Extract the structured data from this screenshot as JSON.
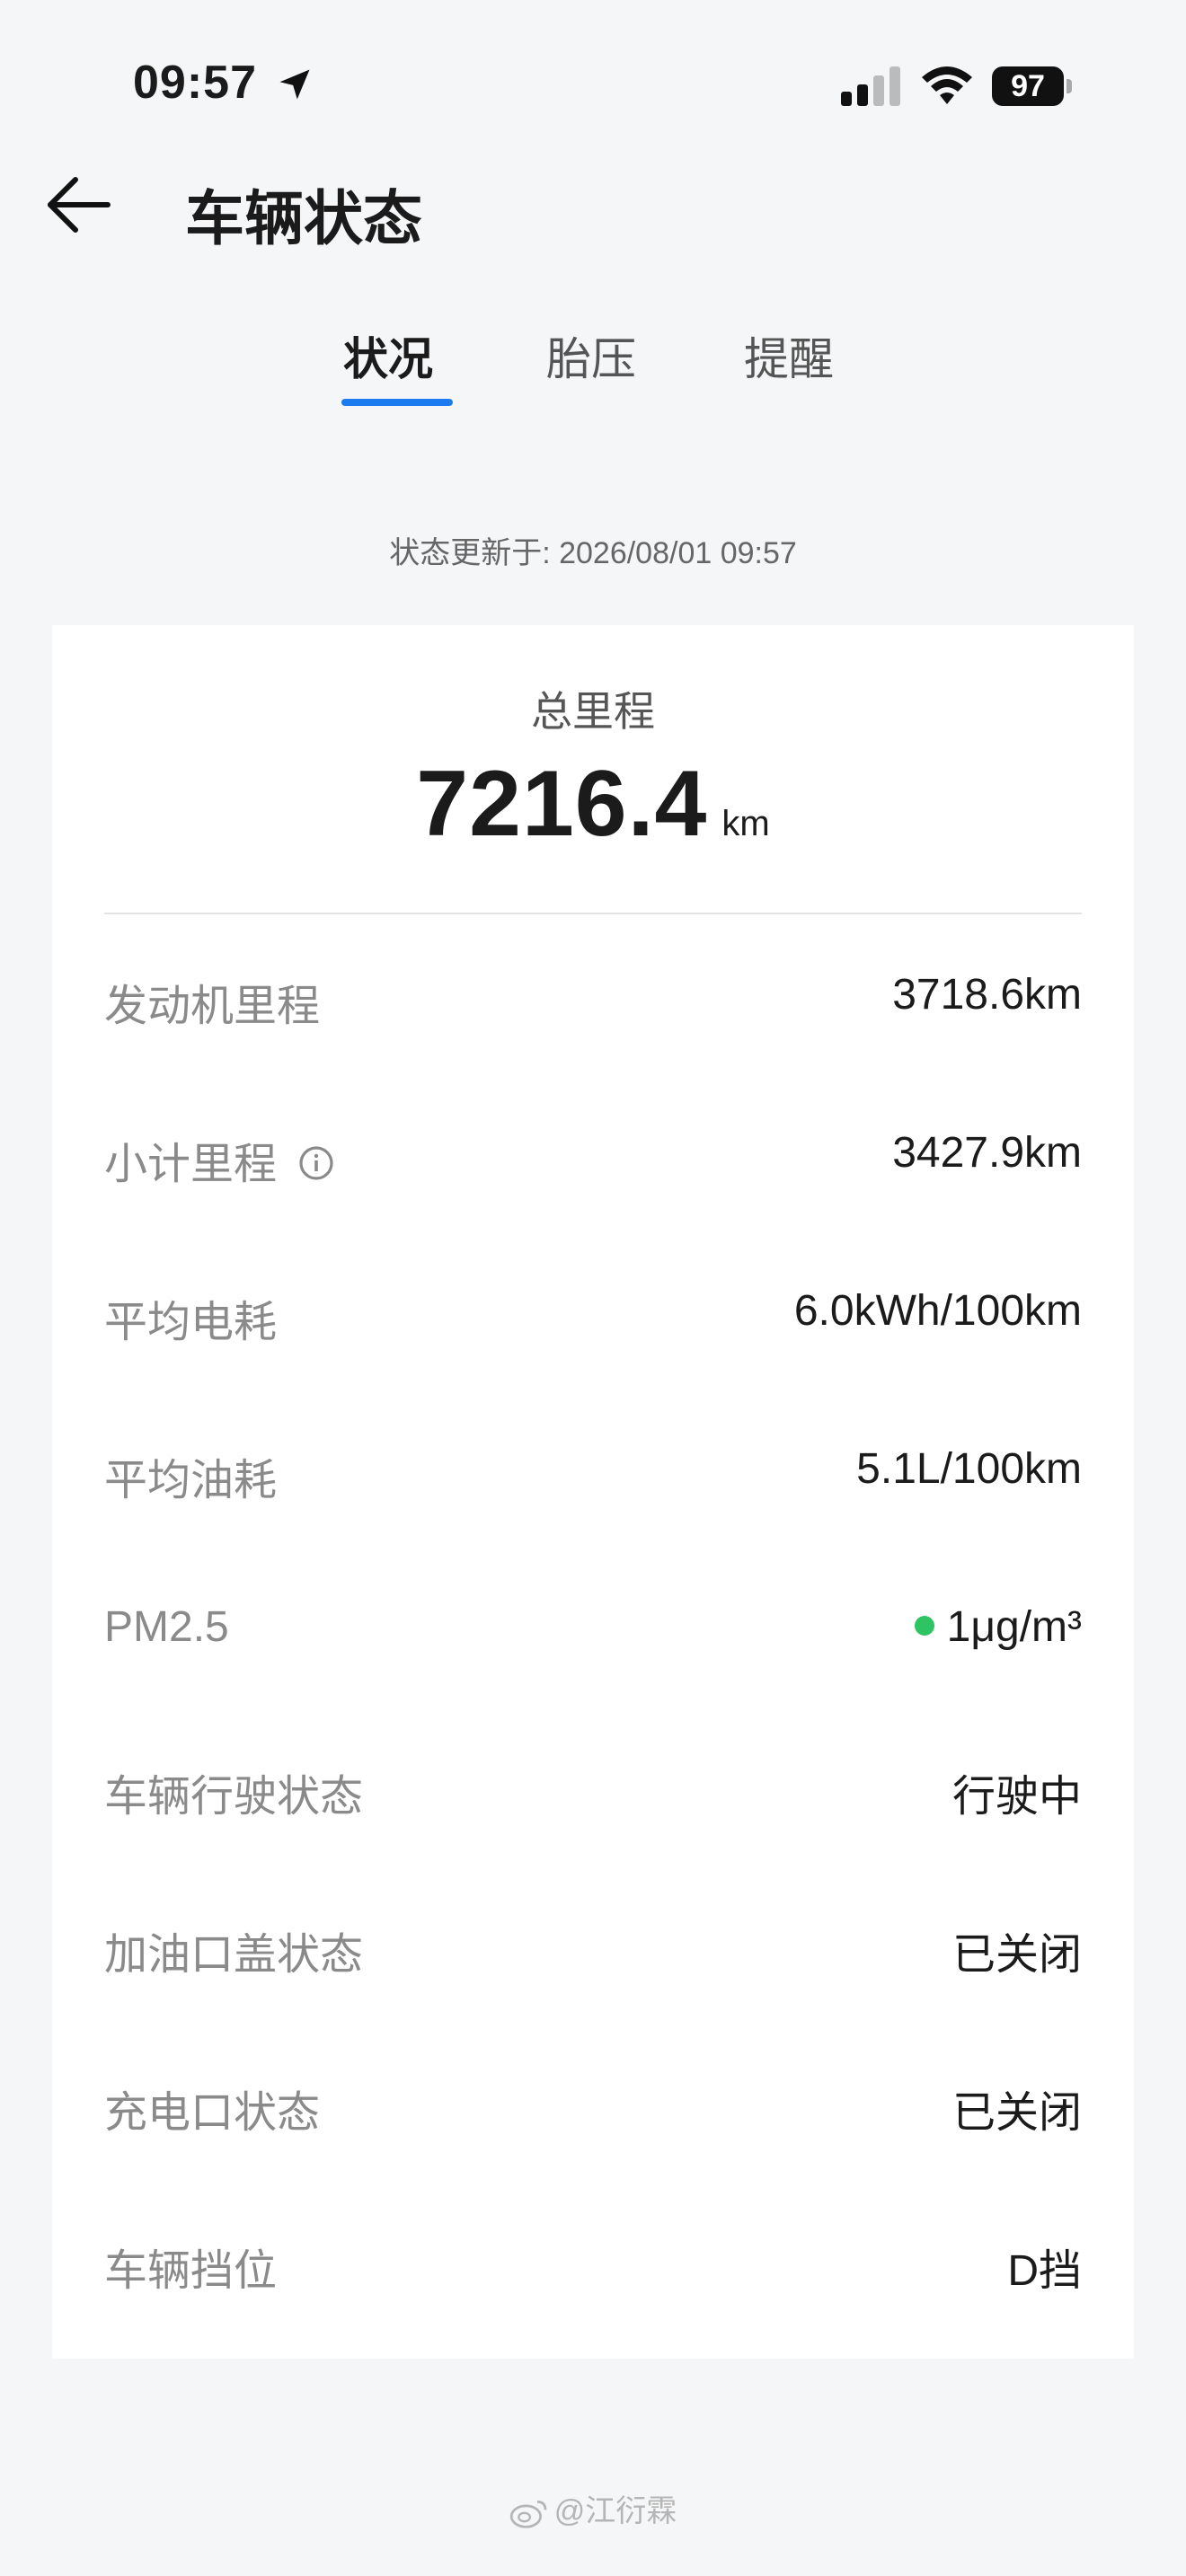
{
  "status_bar": {
    "time": "09:57",
    "battery": "97",
    "icons": [
      "location-arrow-icon",
      "cellular-signal-icon",
      "wifi-icon",
      "battery-icon"
    ]
  },
  "header": {
    "title": "车辆状态",
    "back_icon": "arrow-left-icon"
  },
  "tabs": [
    {
      "label": "状况",
      "active": true
    },
    {
      "label": "胎压",
      "active": false
    },
    {
      "label": "提醒",
      "active": false
    }
  ],
  "update_text": "状态更新于: 2026/08/01 09:57",
  "odometer": {
    "label": "总里程",
    "value": "7216.4",
    "unit": "km"
  },
  "rows": [
    {
      "label": "发动机里程",
      "value": "3718.6km"
    },
    {
      "label": "小计里程",
      "value": "3427.9km",
      "icon": "info-icon"
    },
    {
      "label": "平均电耗",
      "value": "6.0kWh/100km"
    },
    {
      "label": "平均油耗",
      "value": "5.1L/100km"
    },
    {
      "label": "PM2.5",
      "value": "1μg/m³",
      "status_color": "#2fc463"
    },
    {
      "label": "车辆行驶状态",
      "value": "行驶中"
    },
    {
      "label": "加油口盖状态",
      "value": "已关闭"
    },
    {
      "label": "充电口状态",
      "value": "已关闭"
    },
    {
      "label": "车辆挡位",
      "value": "D挡"
    }
  ],
  "watermark": "@江衍霖",
  "colors": {
    "accent": "#1a7cf0",
    "background": "#f5f6f7",
    "card": "#ffffff",
    "label": "#8a8a8a",
    "good_status": "#2fc463"
  }
}
